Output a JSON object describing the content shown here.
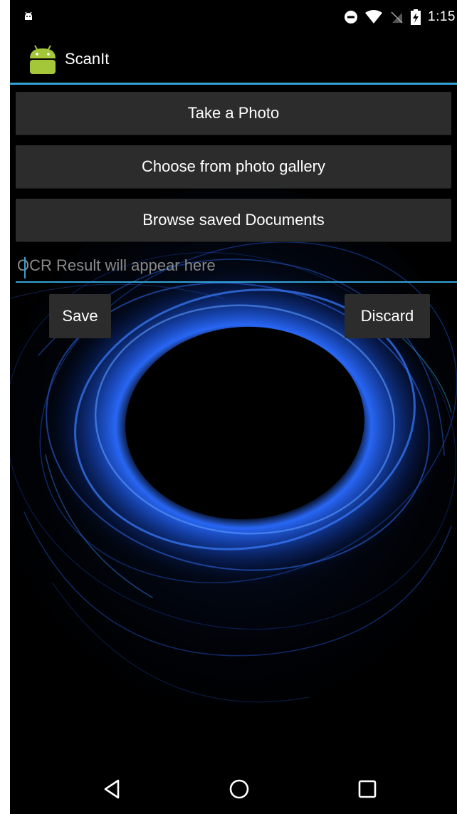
{
  "status_bar": {
    "time": "1:15",
    "icons": [
      "android-debug-icon",
      "do-not-disturb-icon",
      "wifi-icon",
      "no-sim-icon",
      "battery-charging-icon"
    ]
  },
  "action_bar": {
    "title": "ScanIt",
    "logo": "android-robot-icon",
    "accent_color": "#33a3d6"
  },
  "main": {
    "take_photo_label": "Take a Photo",
    "gallery_label": "Choose from photo gallery",
    "browse_label": "Browse saved Documents",
    "ocr_placeholder": "OCR Result will appear here",
    "ocr_value": "",
    "save_label": "Save",
    "discard_label": "Discard",
    "button_color": "#2c2c2c"
  },
  "nav_bar": {
    "back": "back-triangle-icon",
    "home": "home-circle-icon",
    "recents": "recents-square-icon"
  }
}
